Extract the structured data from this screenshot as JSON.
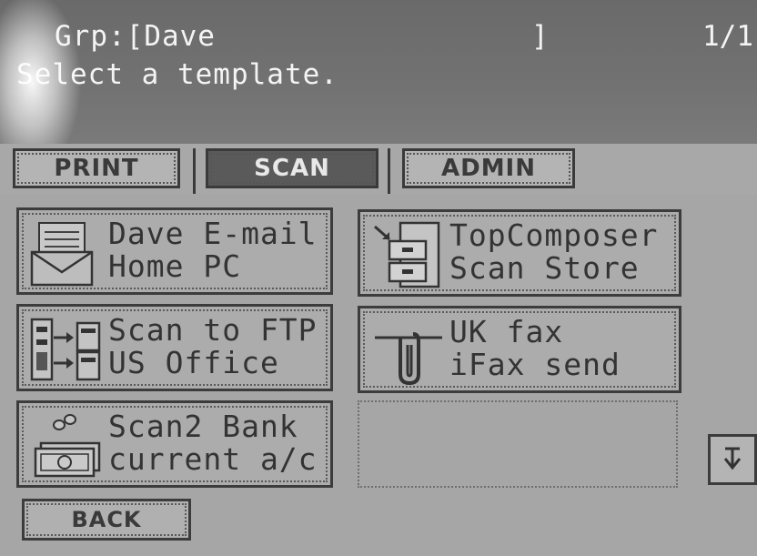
{
  "header": {
    "group_label": "Grp:[Dave",
    "group_close": "]",
    "page_indicator": "1/1",
    "instruction": "Select a template."
  },
  "tabs": [
    {
      "label": "PRINT",
      "selected": false
    },
    {
      "label": "SCAN",
      "selected": true
    },
    {
      "label": "ADMIN",
      "selected": false
    }
  ],
  "templates": [
    {
      "line1": "Dave E-mail",
      "line2": "Home PC",
      "icon": "email-envelope-icon"
    },
    {
      "line1": "TopComposer",
      "line2": "Scan Store",
      "icon": "filing-cabinet-icon"
    },
    {
      "line1": "Scan to FTP",
      "line2": "US Office",
      "icon": "ftp-server-icon"
    },
    {
      "line1": "UK fax",
      "line2": "iFax send",
      "icon": "fax-paperclip-icon"
    },
    {
      "line1": "Scan2 Bank",
      "line2": "current a/c",
      "icon": "money-icon"
    }
  ],
  "footer": {
    "back_label": "BACK"
  },
  "scroll": {
    "icon": "scroll-down-icon"
  }
}
